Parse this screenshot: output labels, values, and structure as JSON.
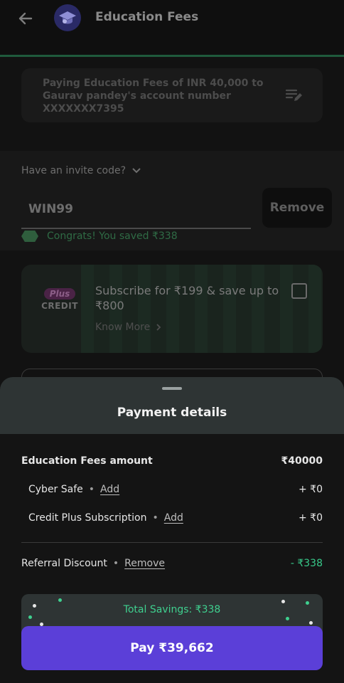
{
  "header": {
    "title": "Education Fees"
  },
  "payment_info": {
    "text": "Paying Education Fees of INR 40,000 to Gaurav pandey's account number XXXXXXX7395"
  },
  "invite": {
    "question": "Have an invite code?",
    "code": "WIN99",
    "remove_label": "Remove",
    "congrats": "Congrats! You saved ₹338"
  },
  "subscription": {
    "badge_plus": "Plus",
    "badge_credit": "CREDIT",
    "text": "Subscribe for ₹199 & save up to ₹800",
    "know_more": "Know More"
  },
  "sheet": {
    "title": "Payment details",
    "fees_label": "Education Fees amount",
    "fees_amount": "₹40000",
    "cyber_label": "Cyber Safe",
    "cyber_add": "Add",
    "cyber_amount": "+ ₹0",
    "credit_label": "Credit Plus Subscription",
    "credit_add": "Add",
    "credit_amount": "+ ₹0",
    "referral_label": "Referral Discount",
    "referral_remove": "Remove",
    "referral_amount": "- ₹338",
    "savings": "Total Savings: ₹338",
    "pay_label": "Pay ₹39,662"
  },
  "colors": {
    "accent": "#5b3fd8",
    "savings_green": "#3fd08f"
  }
}
